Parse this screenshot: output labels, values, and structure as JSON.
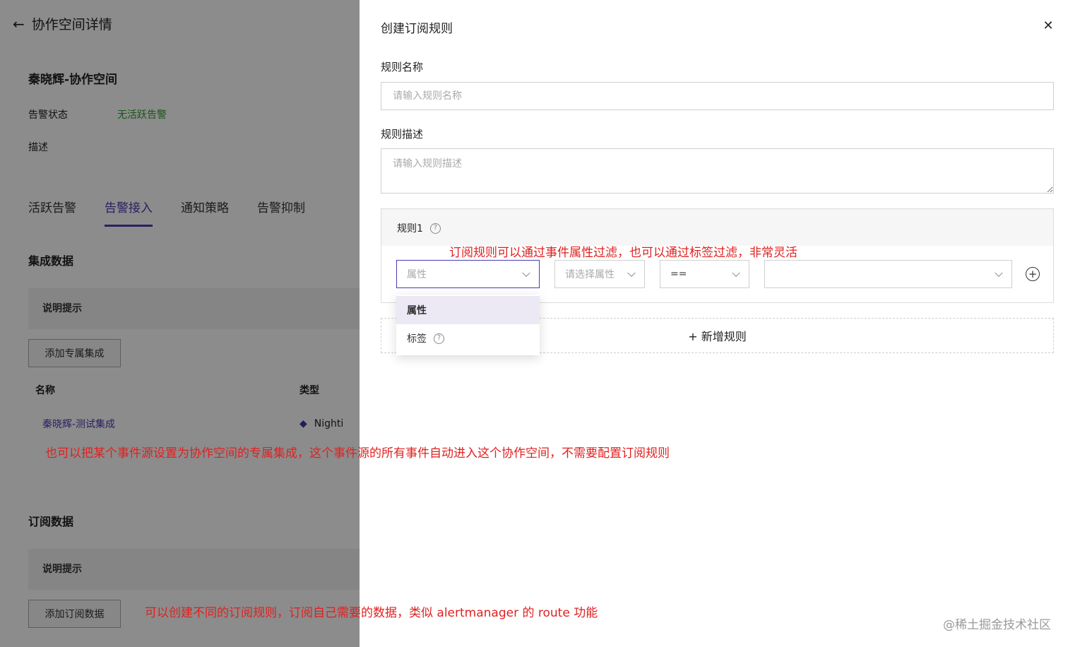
{
  "background": {
    "title": "协作空间详情",
    "space_name": "秦晓辉-协作空间",
    "status_label": "告警状态",
    "status_value": "无活跃告警",
    "desc_label": "描述",
    "tabs": [
      {
        "label": "活跃告警"
      },
      {
        "label": "告警接入"
      },
      {
        "label": "通知策略"
      },
      {
        "label": "告警抑制"
      }
    ],
    "integration": {
      "section_title": "集成数据",
      "hint": "说明提示",
      "add_button": "添加专属集成",
      "table_headers": [
        "名称",
        "类型"
      ],
      "row": {
        "name": "秦晓辉-测试集成",
        "type": "Nighti"
      }
    },
    "subscription": {
      "section_title": "订阅数据",
      "hint": "说明提示",
      "add_button": "添加订阅数据"
    }
  },
  "drawer": {
    "title": "创建订阅规则",
    "name_label": "规则名称",
    "name_placeholder": "请输入规则名称",
    "desc_label": "规则描述",
    "desc_placeholder": "请输入规则描述",
    "rule": {
      "title": "规则1",
      "type_select": "属性",
      "attr_select": "请选择属性",
      "op_select": "==",
      "value_select": ""
    },
    "add_rule": "+ 新增规则",
    "dropdown_options": [
      {
        "label": "属性",
        "selected": true
      },
      {
        "label": "标签",
        "selected": false
      }
    ]
  },
  "annotations": {
    "rule_filter": "订阅规则可以通过事件属性过滤，也可以通过标签过滤，非常灵活",
    "exclusive_integration": "也可以把某个事件源设置为协作空间的专属集成，这个事件源的所有事件自动进入这个协作空间，不需要配置订阅规则",
    "route": "可以创建不同的订阅规则，订阅自己需要的数据，类似 alertmanager 的 route 功能"
  },
  "watermark": "@稀土掘金技术社区",
  "colors": {
    "accent": "#4b3bb0",
    "status_ok": "#2a9c2a",
    "annotation": "#e02020"
  }
}
